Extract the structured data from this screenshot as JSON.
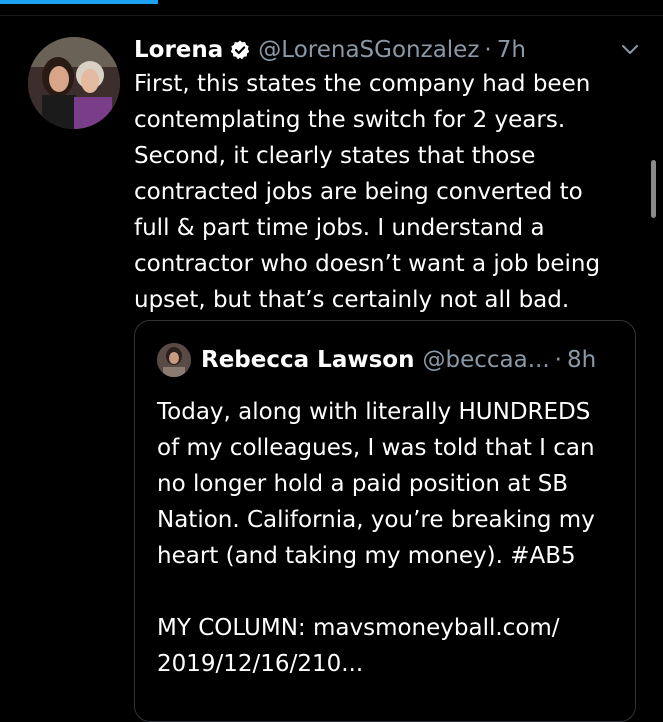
{
  "tweet": {
    "name": "Lorena",
    "handle": "@LorenaSGonzalez",
    "separator": "·",
    "time": "7h",
    "text": "First, this states the company had been\ncontemplating the switch for 2 years.\nSecond, it clearly states that those\ncontracted jobs are being converted to\nfull & part time jobs. I understand a\ncontractor who doesn’t want a job being\nupset, but that’s certainly not all bad."
  },
  "quote": {
    "name": "Rebecca Lawson",
    "handle": "@beccaa...",
    "separator": "·",
    "time": "8h",
    "text": "Today, along with literally HUNDREDS\nof my colleagues, I was told that I can\nno longer hold a paid position at SB\nNation. California, you’re breaking my\nheart (and taking my money). #AB5\n\nMY COLUMN: mavsmoneyball.com/\n2019/12/16/210..."
  },
  "colors": {
    "background": "#000000",
    "text": "#ffffff",
    "secondary": "#8b98a5",
    "accent": "#1DA1F2",
    "border": "#2f3336"
  },
  "icons": [
    "verified-badge-icon",
    "chevron-down-icon"
  ]
}
